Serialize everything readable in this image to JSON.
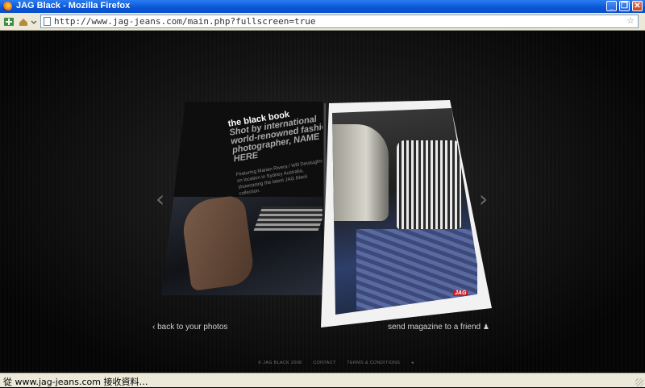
{
  "window": {
    "title": "JAG Black - Mozilla Firefox",
    "buttons": {
      "minimize": "_",
      "maximize": "❐",
      "close": "✕"
    }
  },
  "navbar": {
    "url": "http://www.jag-jeans.com/main.php?fullscreen=true",
    "icons": [
      "reload-icon",
      "home-icon",
      "page-icon",
      "bookmark-star-icon"
    ]
  },
  "magazine": {
    "left_page": {
      "title": "the black book",
      "subtitle": "Shot by international world-renowned fashion photographer, NAME HERE",
      "description": "Featuring Marian Rivera / Will Devaughn on location in Sydney Australia, showcasing the latest JAG Black collection."
    },
    "right_page": {
      "logo_top": "JAG",
      "logo_bottom": "BLACK"
    },
    "prev_arrow": "‹",
    "next_arrow": "›"
  },
  "links": {
    "back": "‹ back to your photos",
    "send": "send magazine to a friend"
  },
  "footer": {
    "copyright": "© JAG BLACK 2008",
    "contact": "CONTACT",
    "terms": "TERMS & CONDITIONS"
  },
  "statusbar": {
    "text": "從 www.jag-jeans.com 接收資料…"
  }
}
